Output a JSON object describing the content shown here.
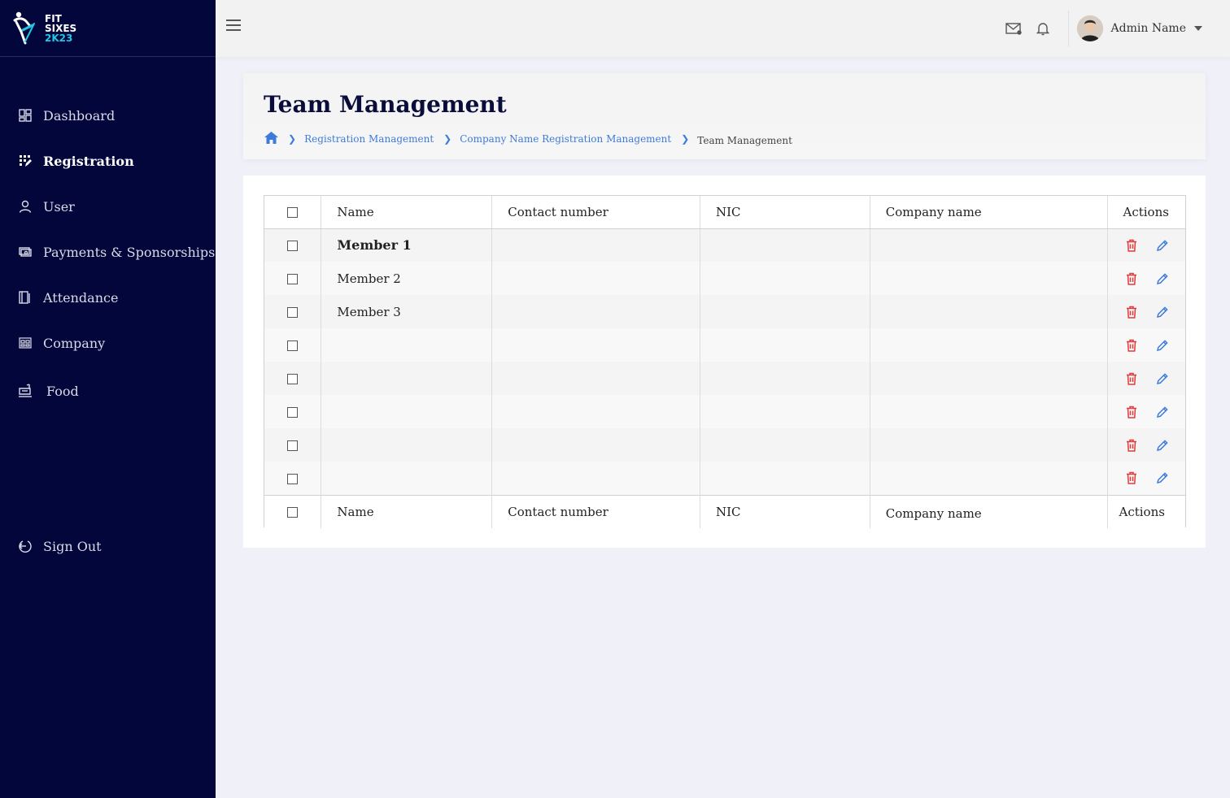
{
  "brand": {
    "line1": "FIT",
    "line2": "SIXES",
    "line3": "2K23"
  },
  "sidebar": {
    "items": [
      {
        "label": "Dashboard",
        "icon": "dashboard-icon"
      },
      {
        "label": "Registration",
        "icon": "registration-icon",
        "active": true
      },
      {
        "label": "User",
        "icon": "user-icon"
      },
      {
        "label": "Payments & Sponsorships",
        "icon": "payments-icon"
      },
      {
        "label": "Attendance",
        "icon": "attendance-icon"
      },
      {
        "label": "Company",
        "icon": "company-icon"
      },
      {
        "label": "Food",
        "icon": "food-icon"
      }
    ],
    "signout": "Sign Out"
  },
  "topbar": {
    "user_name": "Admin Name"
  },
  "page": {
    "title": "Team Management",
    "breadcrumb": [
      "Registration Management",
      "Company Name Registration Management",
      "Team Management"
    ]
  },
  "table": {
    "headers": [
      "Name",
      "Contact number",
      "NIC",
      "Company name",
      "Actions"
    ],
    "footers": [
      "Name",
      "Contact number",
      "NIC",
      "Company name",
      "Actions"
    ],
    "rows": [
      {
        "name": "Member 1"
      },
      {
        "name": "Member 2"
      },
      {
        "name": "Member 3"
      },
      {
        "name": ""
      },
      {
        "name": ""
      },
      {
        "name": ""
      },
      {
        "name": ""
      },
      {
        "name": ""
      }
    ]
  },
  "colors": {
    "sidebar_bg": "#03063a",
    "accent": "#1ec8e6",
    "link": "#3d7bd9",
    "delete": "#e03a3a",
    "edit": "#3d7bd9"
  }
}
